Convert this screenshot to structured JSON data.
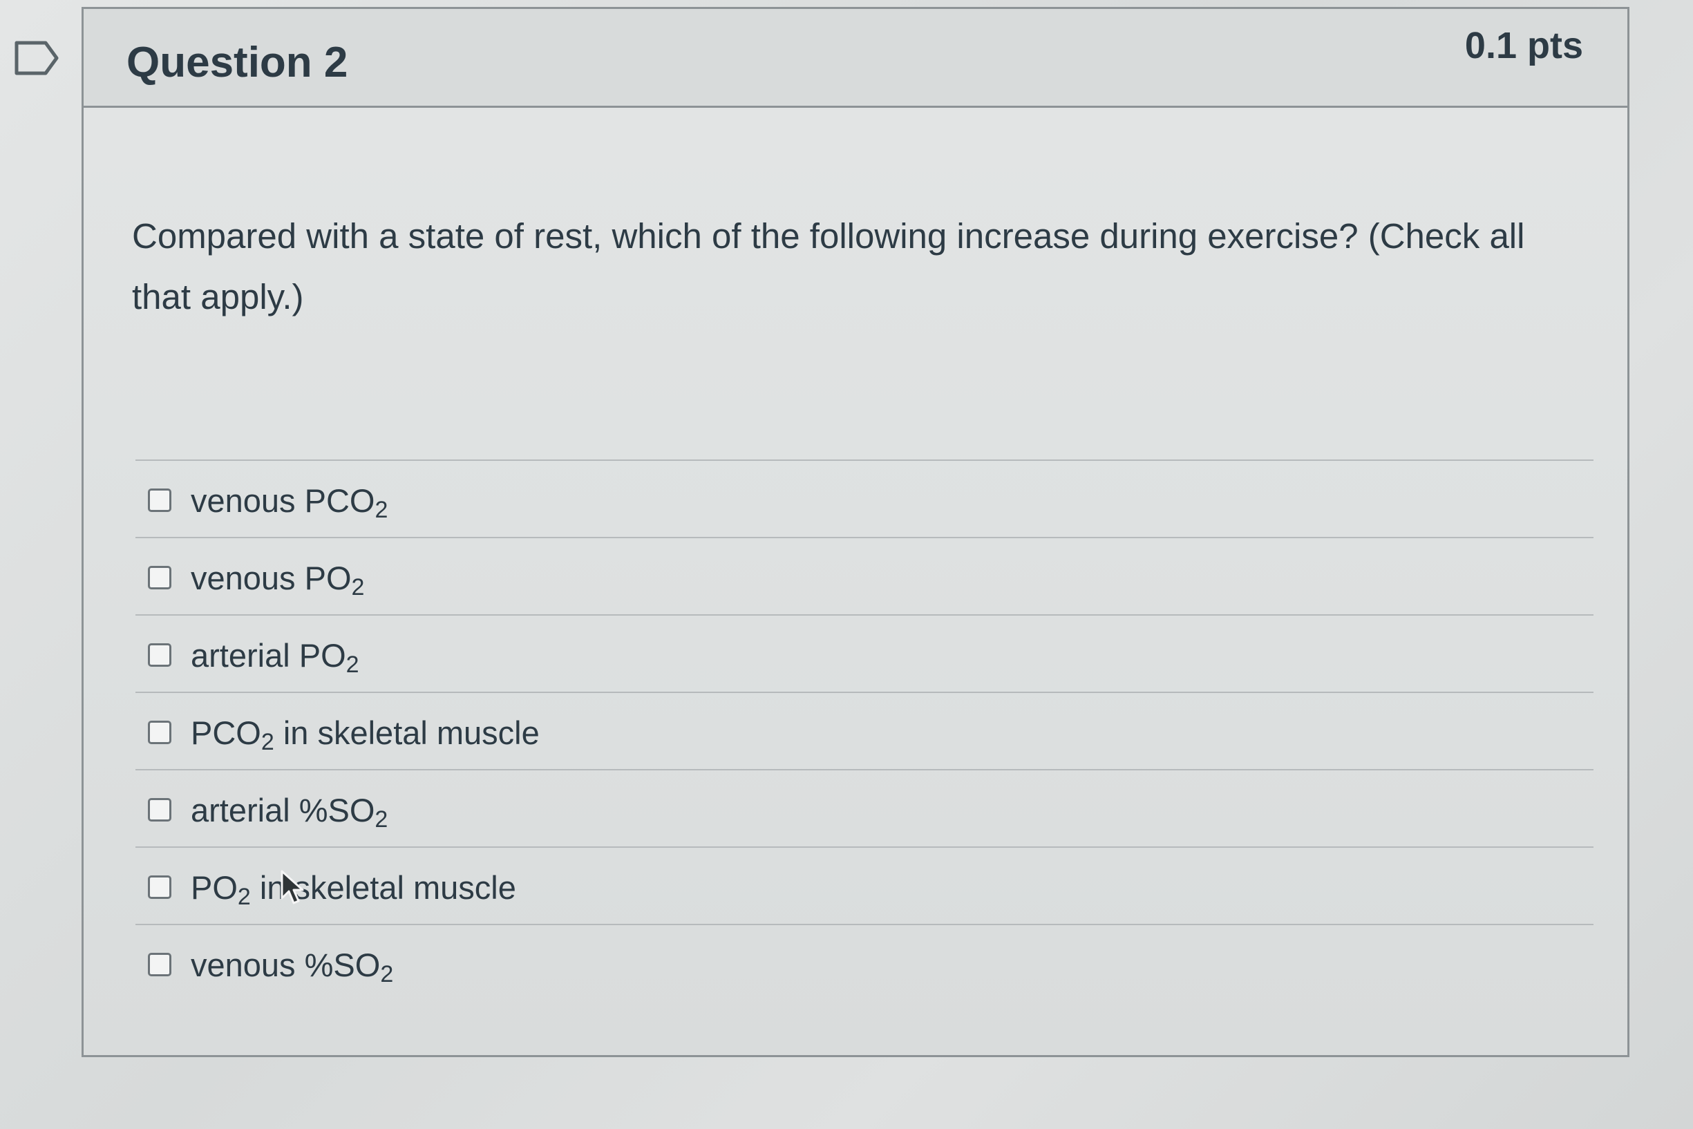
{
  "question": {
    "title": "Question 2",
    "points": "0.1 pts",
    "text": "Compared with a state of rest, which of the following increase during exercise? (Check all that apply.)"
  },
  "answers": [
    {
      "prefix": "venous PCO",
      "sub": "2",
      "suffix": ""
    },
    {
      "prefix": "venous PO",
      "sub": "2",
      "suffix": ""
    },
    {
      "prefix": "arterial PO",
      "sub": "2",
      "suffix": ""
    },
    {
      "prefix": "PCO",
      "sub": "2",
      "suffix": " in skeletal muscle"
    },
    {
      "prefix": "arterial %SO",
      "sub": "2",
      "suffix": ""
    },
    {
      "prefix": "PO",
      "sub": "2",
      "suffix": " in skeletal muscle"
    },
    {
      "prefix": "venous %SO",
      "sub": "2",
      "suffix": ""
    }
  ],
  "icons": {
    "bookmark": "bookmark-icon",
    "cursor": "mouse-cursor-icon"
  },
  "colors": {
    "text": "#2d3b45",
    "border": "#8d9396",
    "checkbox_border": "#6b7378"
  }
}
